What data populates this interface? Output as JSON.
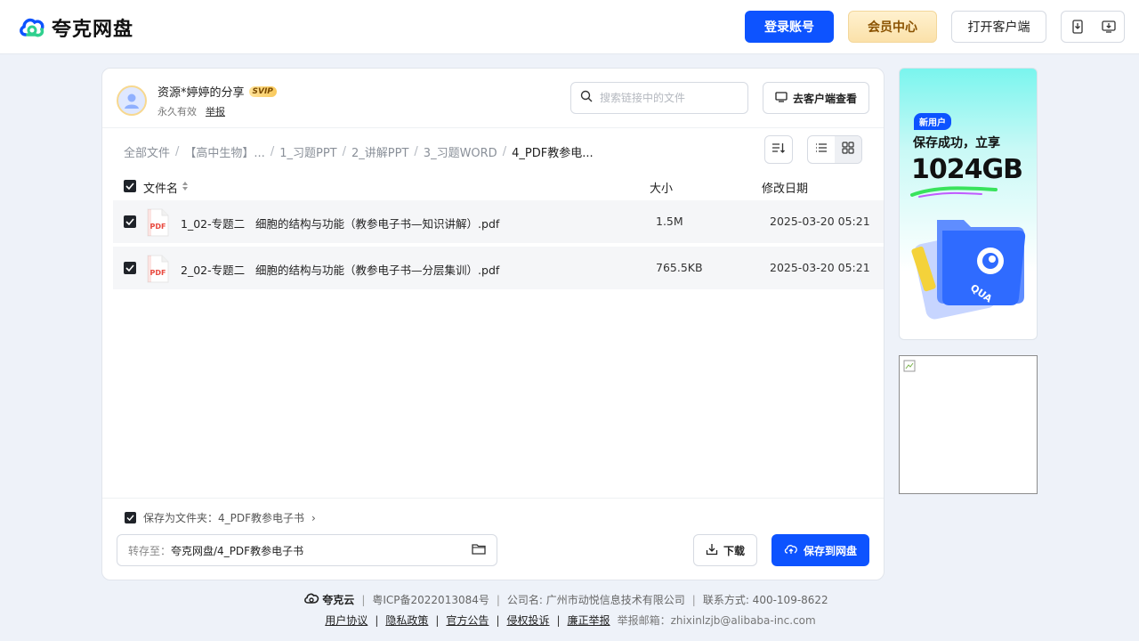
{
  "header": {
    "brand": "夸克网盘",
    "login_label": "登录账号",
    "vip_label": "会员中心",
    "client_label": "打开客户端"
  },
  "sharer": {
    "name": "资源*婷婷的分享",
    "badge": "SVIP",
    "validity": "永久有效",
    "report": "举报"
  },
  "search": {
    "placeholder": "搜索链接中的文件"
  },
  "view_client_label": "去客户端查看",
  "breadcrumb": [
    "全部文件",
    "【高中生物】...",
    "1_习题PPT",
    "2_讲解PPT",
    "3_习题WORD",
    "4_PDF教参电..."
  ],
  "table": {
    "headers": {
      "name": "文件名",
      "size": "大小",
      "date": "修改日期"
    },
    "rows": [
      {
        "name": "1_02-专题二   细胞的结构与功能（教参电子书—知识讲解）.pdf",
        "size": "1.5M",
        "date": "2025-03-20 05:21",
        "icon_text": "PDF"
      },
      {
        "name": "2_02-专题二   细胞的结构与功能（教参电子书—分层集训）.pdf",
        "size": "765.5KB",
        "date": "2025-03-20 05:21",
        "icon_text": "PDF"
      }
    ]
  },
  "save_as": {
    "text": "保存为文件夹：4_PDF教参电子书",
    "chevron": "›"
  },
  "save_path": {
    "label": "转存至：",
    "value": "夸克网盘/4_PDF教参电子书"
  },
  "download_label": "下载",
  "save_label": "保存到网盘",
  "ad": {
    "tag": "新用户",
    "line1": "保存成功，立享",
    "big": "1024GB"
  },
  "footer": {
    "logo": "夸克云",
    "icp": "粤ICP备2022013084号",
    "company": "公司名: 广州市动悦信息技术有限公司",
    "contact": "联系方式: 400-109-8622",
    "links": [
      "用户协议",
      "隐私政策",
      "官方公告",
      "侵权投诉",
      "廉正举报"
    ],
    "email": "举报邮箱：zhixinlzjb@alibaba-inc.com"
  },
  "colors": {
    "primary": "#0d53ff",
    "vip_bg": "#fbe1a9",
    "page_bg": "#eef2f9",
    "pdf_red": "#e8493f"
  }
}
